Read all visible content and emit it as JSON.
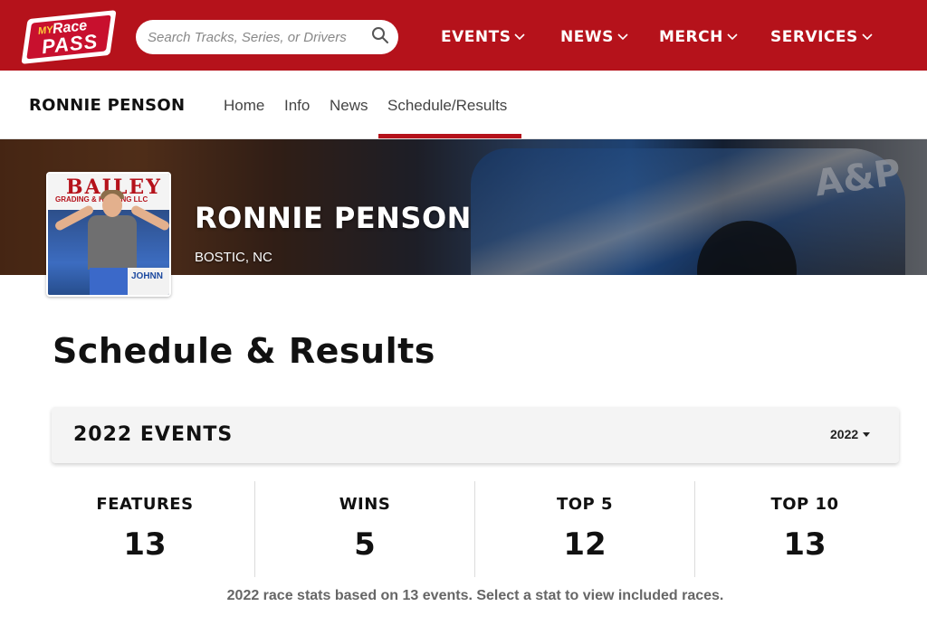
{
  "header": {
    "logo": {
      "my": "MY",
      "race": "Race",
      "pass": "PASS"
    },
    "search": {
      "placeholder": "Search Tracks, Series, or Drivers",
      "value": ""
    },
    "nav": [
      {
        "label": "EVENTS"
      },
      {
        "label": "NEWS"
      },
      {
        "label": "MERCH"
      },
      {
        "label": "SERVICES"
      }
    ],
    "accent_color": "#b5121b"
  },
  "subnav": {
    "title": "RONNIE PENSON",
    "links": [
      {
        "label": "Home"
      },
      {
        "label": "Info"
      },
      {
        "label": "News"
      },
      {
        "label": "Schedule/Results",
        "active": true
      }
    ]
  },
  "profile": {
    "name": "RONNIE PENSON",
    "location": "BOSTIC, NC",
    "photo_sign": "BAILEY",
    "photo_sign_sub": "GRADING & HAULING LLC",
    "photo_sign2": "JOHNN"
  },
  "page": {
    "title": "Schedule & Results",
    "events_title": "2022 EVENTS",
    "year_selected": "2022"
  },
  "stats": [
    {
      "label": "FEATURES",
      "value": "13"
    },
    {
      "label": "WINS",
      "value": "5"
    },
    {
      "label": "TOP 5",
      "value": "12"
    },
    {
      "label": "TOP 10",
      "value": "13"
    }
  ],
  "stats_note": "2022 race stats based on 13 events. Select a stat to view included races."
}
